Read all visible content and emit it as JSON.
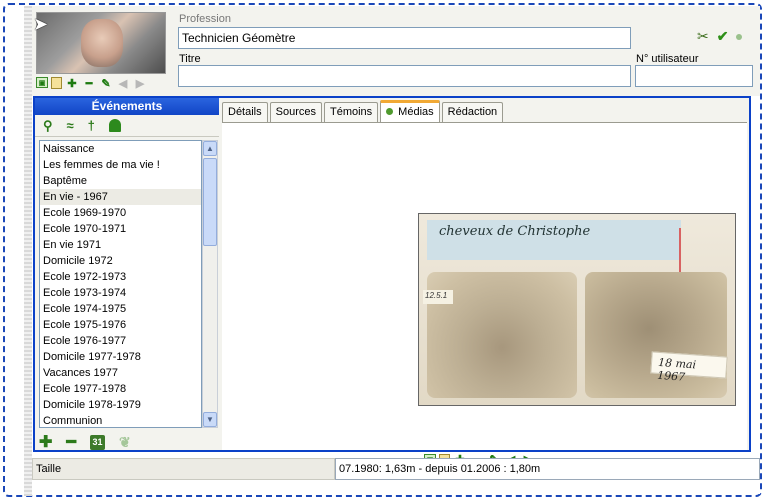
{
  "profile": {
    "profession_label": "Profession",
    "profession_value": "Technicien Géomètre",
    "titre_label": "Titre",
    "titre_value": "",
    "user_number_label": "N° utilisateur",
    "user_number_value": ""
  },
  "events": {
    "title": "Événements",
    "items": [
      "Naissance",
      "Les femmes de ma vie !",
      "Baptême",
      "En vie - 1967",
      "Ecole 1969-1970",
      "Ecole 1970-1971",
      "En vie 1971",
      "Domicile 1972",
      "Ecole 1972-1973",
      "Ecole 1973-1974",
      "Ecole 1974-1975",
      "Ecole 1975-1976",
      "Ecole 1976-1977",
      "Domicile 1977-1978",
      "Vacances 1977",
      "Ecole 1977-1978",
      "Domicile 1978-1979",
      "Communion"
    ],
    "selected_index": 3
  },
  "tabs": [
    "Détails",
    "Sources",
    "Témoins",
    "Médias",
    "Rédaction"
  ],
  "active_tab": "Médias",
  "media": {
    "label_text": "cheveux de Christophe",
    "tag_small": "12.5.1",
    "tag_date": "18 mai 1967"
  },
  "calendar_icon_text": "31",
  "bottom": {
    "label": "Taille",
    "value": "07.1980: 1,63m - depuis 01.2006 : 1,80m"
  }
}
